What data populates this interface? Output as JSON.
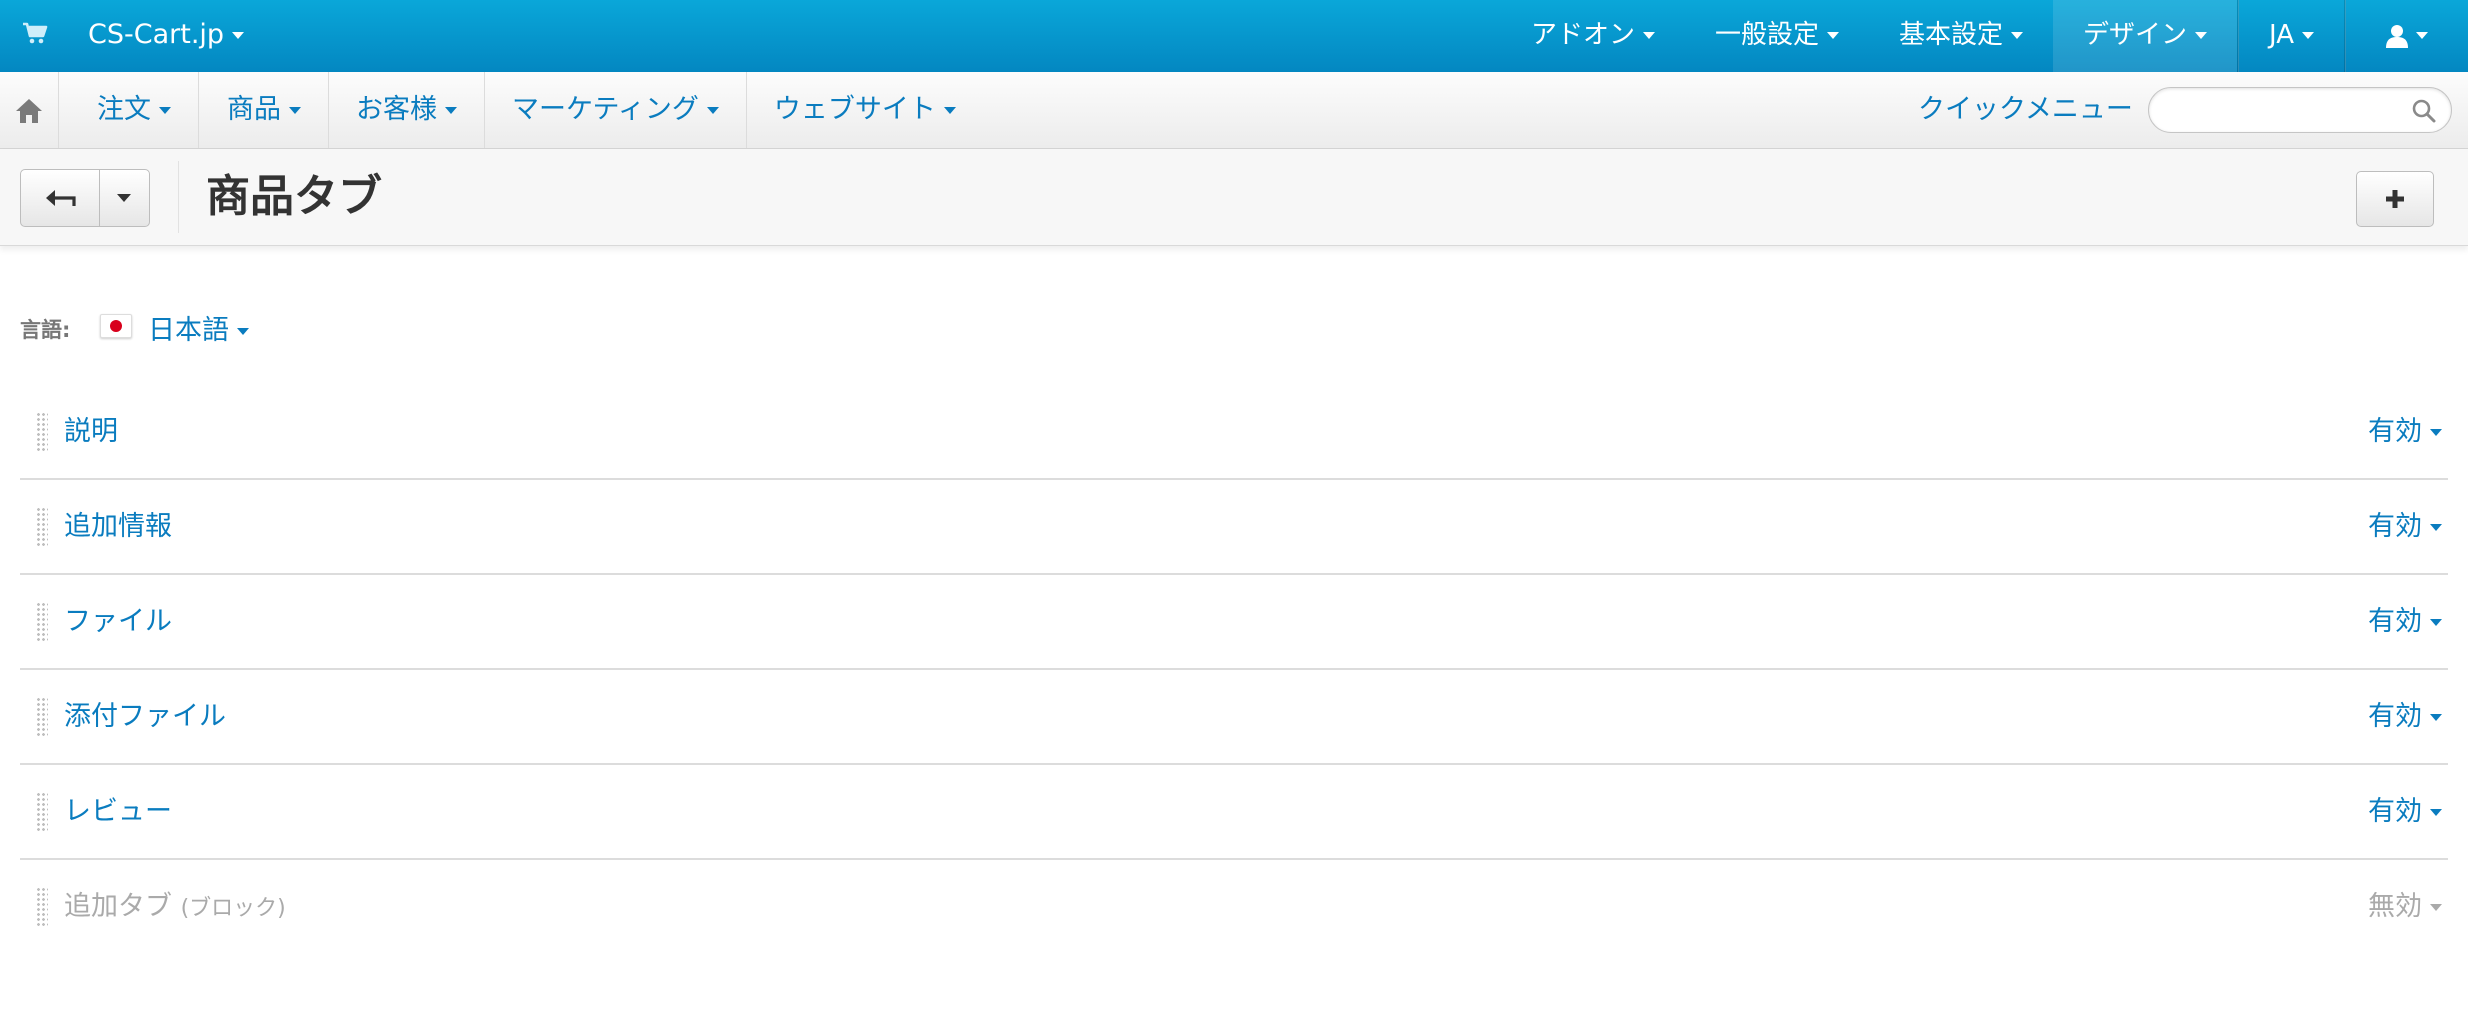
{
  "topbar": {
    "brand": "CS-Cart.jp",
    "menu": [
      {
        "label": "アドオン"
      },
      {
        "label": "一般設定"
      },
      {
        "label": "基本設定"
      },
      {
        "label": "デザイン"
      },
      {
        "label": "JA"
      }
    ]
  },
  "nav": {
    "items": [
      {
        "label": "注文"
      },
      {
        "label": "商品"
      },
      {
        "label": "お客様"
      },
      {
        "label": "マーケティング"
      },
      {
        "label": "ウェブサイト"
      }
    ],
    "quick_menu": "クイックメニュー",
    "search": {
      "value": "",
      "placeholder": ""
    }
  },
  "toolbar": {
    "title": "商品タブ"
  },
  "language": {
    "label": "言語:",
    "value": "日本語"
  },
  "tabs": [
    {
      "name": "説明",
      "sub": "",
      "status": "有効",
      "enabled": true
    },
    {
      "name": "追加情報",
      "sub": "",
      "status": "有効",
      "enabled": true
    },
    {
      "name": "ファイル",
      "sub": "",
      "status": "有効",
      "enabled": true
    },
    {
      "name": "添付ファイル",
      "sub": "",
      "status": "有効",
      "enabled": true
    },
    {
      "name": "レビュー",
      "sub": "",
      "status": "有効",
      "enabled": true
    },
    {
      "name": "追加タブ",
      "sub": "(ブロック)",
      "status": "無効",
      "enabled": false
    }
  ],
  "colors": {
    "topbar": "#0597cd",
    "link": "#0a7cbf",
    "disabled": "#aaaaaa"
  }
}
